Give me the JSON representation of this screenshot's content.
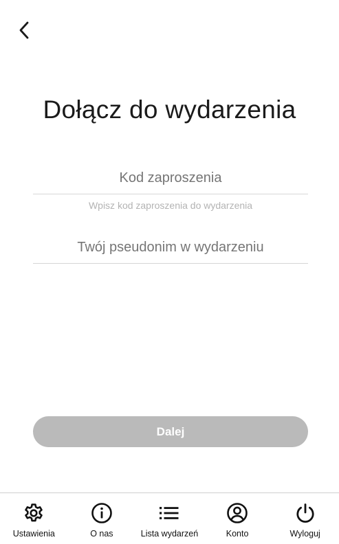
{
  "header": {
    "back_icon": "chevron-left-icon"
  },
  "main": {
    "title": "Dołącz do wydarzenia",
    "invite_code": {
      "placeholder": "Kod zaproszenia",
      "value": "",
      "helper": "Wpisz kod zaproszenia do wydarzenia"
    },
    "nickname": {
      "placeholder": "Twój pseudonim w wydarzeniu",
      "value": ""
    },
    "next_button": {
      "label": "Dalej",
      "disabled": true,
      "color": "#bababa"
    }
  },
  "bottom_nav": {
    "items": [
      {
        "label": "Ustawienia",
        "icon": "gear-icon"
      },
      {
        "label": "O nas",
        "icon": "info-icon"
      },
      {
        "label": "Lista wydarzeń",
        "icon": "list-icon"
      },
      {
        "label": "Konto",
        "icon": "account-icon"
      },
      {
        "label": "Wyloguj",
        "icon": "power-icon"
      }
    ]
  }
}
